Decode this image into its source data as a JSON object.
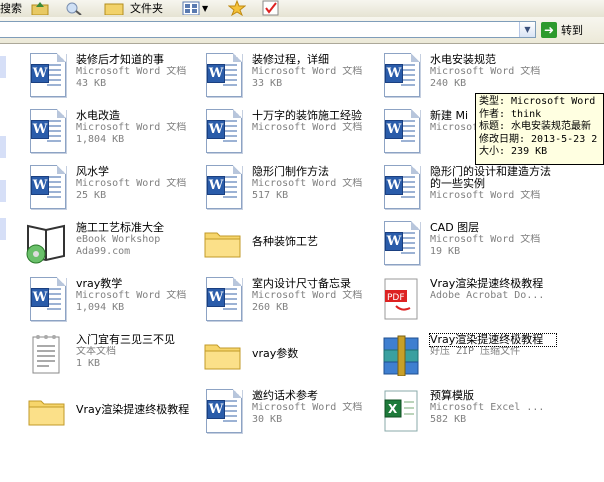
{
  "toolbar": {
    "search_label": "搜索",
    "folders_label": "文件夹"
  },
  "address": {
    "value": "",
    "go_label": "转到"
  },
  "tooltip": {
    "type": "类型: Microsoft Word",
    "author": "作者: think",
    "title": "标题: 水电安装规范最新",
    "modified": "修改日期: 2013-5-23 2",
    "size": "大小: 239 KB"
  },
  "files": [
    {
      "name": "装修后才知道的事",
      "type": "Microsoft Word 文档",
      "size": "43 KB",
      "icon": "word-doc-icon"
    },
    {
      "name": "装修过程，详细",
      "type": "Microsoft Word 文档",
      "size": "33 KB",
      "icon": "word-doc-icon"
    },
    {
      "name": "水电安装规范",
      "type": "Microsoft Word 文档",
      "size": "240 KB",
      "icon": "word-doc-icon"
    },
    {
      "name": "水电改造",
      "type": "Microsoft Word 文档",
      "size": "1,804 KB",
      "icon": "word-doc-icon"
    },
    {
      "name": "十万字的装饰施工经验",
      "type": "Microsoft Word 文档",
      "size": "",
      "icon": "word-doc-icon"
    },
    {
      "name": "新建 Mi",
      "type": "Microsoft",
      "size": "",
      "icon": "word-doc-icon"
    },
    {
      "name": "风水学",
      "type": "Microsoft Word 文档",
      "size": "25 KB",
      "icon": "word-doc-icon"
    },
    {
      "name": "隐形门制作方法",
      "type": "Microsoft Word 文档",
      "size": "517 KB",
      "icon": "word-doc-icon"
    },
    {
      "name": "隐形门的设计和建造方法的一些实例",
      "type": "Microsoft Word 文档",
      "size": "",
      "icon": "word-doc-icon"
    },
    {
      "name": "施工工艺标准大全",
      "type": "eBook Workshop",
      "size": "Ada99.com",
      "icon": "ebook-icon"
    },
    {
      "name": "各种装饰工艺",
      "type": "",
      "size": "",
      "icon": "folder-icon"
    },
    {
      "name": "CAD 图层",
      "type": "Microsoft Word 文档",
      "size": "19 KB",
      "icon": "word-doc-icon"
    },
    {
      "name": "vray教学",
      "type": "Microsoft Word 文档",
      "size": "1,094 KB",
      "icon": "word-doc-icon"
    },
    {
      "name": "室内设计尺寸备忘录",
      "type": "Microsoft Word 文档",
      "size": "260 KB",
      "icon": "word-doc-icon"
    },
    {
      "name": "Vray渲染提速终极教程",
      "type": "Adobe Acrobat Do...",
      "size": "",
      "icon": "pdf-icon"
    },
    {
      "name": "入门宜有三见三不见",
      "type": "文本文档",
      "size": "1 KB",
      "icon": "text-doc-icon"
    },
    {
      "name": "vray参数",
      "type": "",
      "size": "",
      "icon": "folder-icon"
    },
    {
      "name": "Vray渲染提速终极教程",
      "type": "好压 ZIP 压缩文件",
      "size": "",
      "icon": "zip-archive-icon"
    },
    {
      "name": "Vray渲染提速终极教程",
      "type": "",
      "size": "",
      "icon": "folder-icon"
    },
    {
      "name": "邀约话术参考",
      "type": "Microsoft Word 文档",
      "size": "30 KB",
      "icon": "word-doc-icon"
    },
    {
      "name": "预算模版",
      "type": "Microsoft Excel ...",
      "size": "582 KB",
      "icon": "excel-icon"
    }
  ]
}
